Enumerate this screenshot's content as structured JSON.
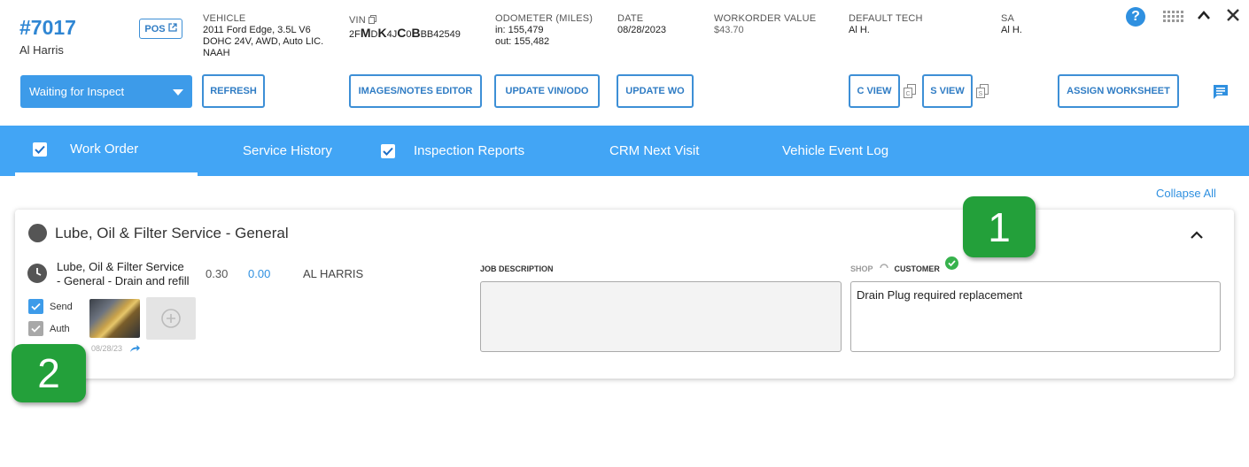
{
  "header": {
    "ro_number": "#7017",
    "customer": "Al Harris",
    "pos_label": "POS",
    "vehicle_label": "VEHICLE",
    "vehicle_lines": [
      "2011 Ford Edge, 3.5L V6",
      "DOHC 24V, AWD, Auto LIC.",
      "NAAH"
    ],
    "vin_label": "VIN",
    "vin_parts": [
      "2F",
      "M",
      "D",
      "K",
      "4J",
      "C",
      "0",
      "B",
      "BB42549"
    ],
    "odometer_label": "ODOMETER (MILES)",
    "odometer_in": "in: 155,479",
    "odometer_out": "out: 155,482",
    "date_label": "DATE",
    "date_value": "08/28/2023",
    "wo_value_label": "WORKORDER VALUE",
    "wo_value": "$43.70",
    "tech_label": "DEFAULT TECH",
    "tech_value": "Al H.",
    "sa_label": "SA",
    "sa_value": "Al H."
  },
  "toolbar": {
    "status_select": "Waiting for Inspect",
    "refresh": "REFRESH",
    "images_notes": "IMAGES/NOTES EDITOR",
    "update_vin": "UPDATE VIN/ODO",
    "update_wo": "UPDATE WO",
    "c_view": "C VIEW",
    "s_view": "S VIEW",
    "assign_worksheet": "ASSIGN WORKSHEET"
  },
  "tabs": [
    {
      "label": "Work Order",
      "checked": true,
      "active": true
    },
    {
      "label": "Service History",
      "checked": false
    },
    {
      "label": "Inspection Reports",
      "checked": true
    },
    {
      "label": "CRM Next Visit",
      "checked": false
    },
    {
      "label": "Vehicle Event Log",
      "checked": false
    }
  ],
  "collapse_all": "Collapse All",
  "job": {
    "title": "Lube, Oil & Filter Service - General",
    "line_name_1": "Lube, Oil & Filter Service",
    "line_name_2": "- General - Drain and refill",
    "hours": "0.30",
    "price": "0.00",
    "tech": "AL HARRIS",
    "send_label": "Send",
    "auth_label": "Auth",
    "photo_date": "08/28/23",
    "job_desc_label": "JOB DESCRIPTION",
    "shop_label": "SHOP",
    "customer_label": "CUSTOMER",
    "customer_note": "Drain Plug required replacement"
  },
  "badges": {
    "one": "1",
    "two": "2"
  },
  "colors": {
    "accent": "#42a5f5",
    "link": "#2f7cc4",
    "badge": "#23a03a"
  }
}
